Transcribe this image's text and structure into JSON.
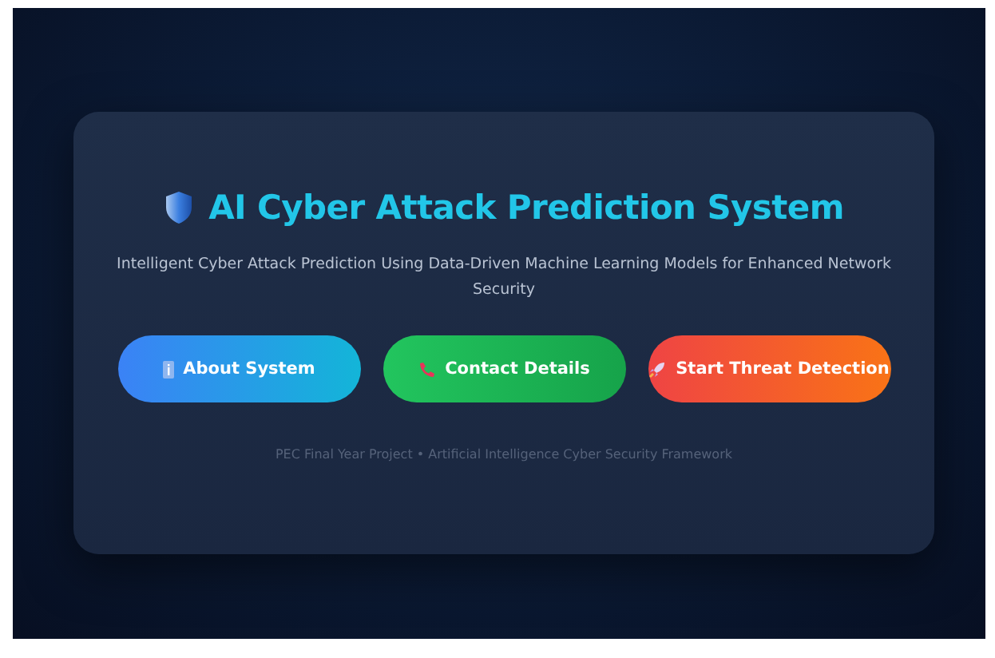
{
  "header": {
    "title": "AI Cyber Attack Prediction System",
    "subtitle": "Intelligent Cyber Attack Prediction Using Data-Driven Machine Learning Models for Enhanced Network Security"
  },
  "buttons": [
    {
      "label": "About System",
      "kind": "about"
    },
    {
      "label": "Contact Details",
      "kind": "contact"
    },
    {
      "label": "Start Threat Detection",
      "kind": "start"
    }
  ],
  "footer": "PEC Final Year Project • Artificial Intelligence Cyber Security Framework"
}
